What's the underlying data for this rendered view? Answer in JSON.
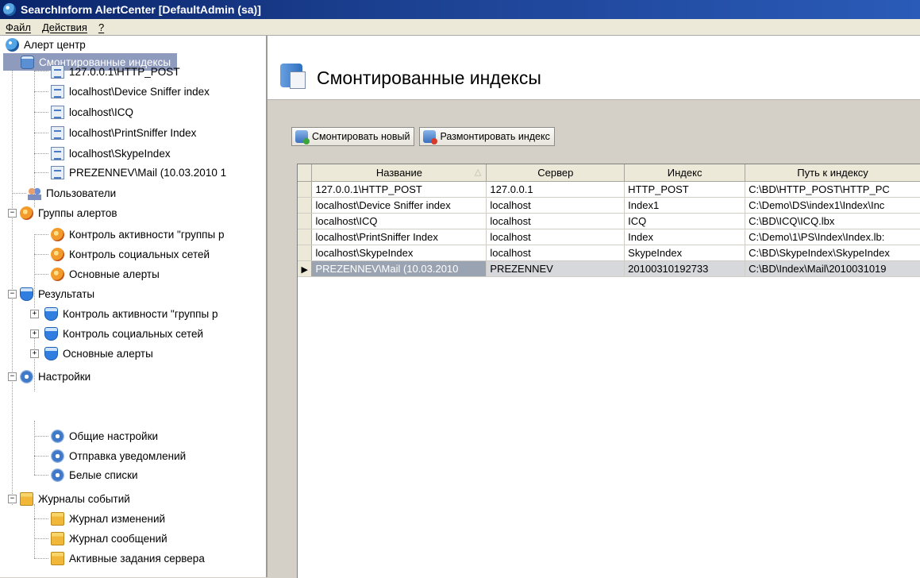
{
  "window": {
    "title": "SearchInform AlertCenter [DefaultAdmin (sa)]"
  },
  "menu": [
    {
      "label": "Файл"
    },
    {
      "label": "Действия"
    },
    {
      "label": "?"
    }
  ],
  "tree": {
    "root": "Алерт центр",
    "mounted": "Смонтированные индексы",
    "indexes": [
      "127.0.0.1\\HTTP_POST",
      "localhost\\Device Sniffer index",
      "localhost\\ICQ",
      "localhost\\PrintSniffer Index",
      "localhost\\SkypeIndex",
      "PREZENNEV\\Mail (10.03.2010 1"
    ],
    "users": "Пользователи",
    "alert_groups": "Группы алертов",
    "alert_group_items": [
      "Контроль активности \"группы р",
      "Контроль социальных сетей",
      "Основные алерты"
    ],
    "results": "Результаты",
    "result_items": [
      "Контроль активности \"группы р",
      "Контроль социальных сетей",
      "Основные алерты"
    ],
    "settings": "Настройки",
    "settings_items": [
      "Общие настройки",
      "Отправка уведомлений",
      "Белые списки"
    ],
    "logs": "Журналы событий",
    "log_items": [
      "Журнал изменений",
      "Журнал сообщений",
      "Активные задания сервера"
    ]
  },
  "header": {
    "title": "Смонтированные индексы"
  },
  "toolbar": {
    "mount_new": "Смонтировать новый",
    "unmount": "Размонтировать индекс"
  },
  "grid": {
    "columns": [
      "Название",
      "Сервер",
      "Индекс",
      "Путь к индексу"
    ],
    "rows": [
      [
        "127.0.0.1\\HTTP_POST",
        "127.0.0.1",
        "HTTP_POST",
        "C:\\BD\\HTTP_POST\\HTTP_PC"
      ],
      [
        "localhost\\Device Sniffer index",
        "localhost",
        "Index1",
        "C:\\Demo\\DS\\index1\\Index\\Inc"
      ],
      [
        "localhost\\ICQ",
        "localhost",
        "ICQ",
        "C:\\BD\\ICQ\\ICQ.lbx"
      ],
      [
        "localhost\\PrintSniffer Index",
        "localhost",
        "Index",
        "C:\\Demo\\1\\PS\\Index\\Index.lb:"
      ],
      [
        "localhost\\SkypeIndex",
        "localhost",
        "SkypeIndex",
        "C:\\BD\\SkypeIndex\\SkypeIndex"
      ],
      [
        "PREZENNEV\\Mail (10.03.2010",
        "PREZENNEV",
        "20100310192733",
        "C:\\BD\\Index\\Mail\\2010031019"
      ]
    ],
    "selected_row": 5
  }
}
